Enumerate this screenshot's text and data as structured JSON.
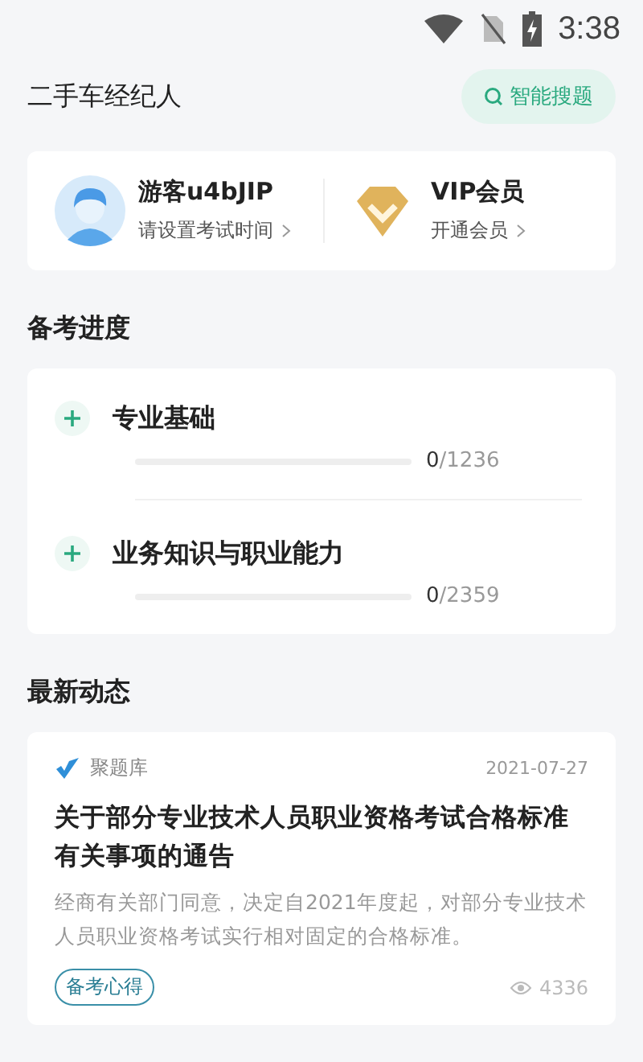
{
  "status_bar": {
    "time": "3:38"
  },
  "header": {
    "title": "二手车经纪人",
    "search_button": "智能搜题"
  },
  "profile": {
    "name": "游客u4bJIP",
    "hint": "请设置考试时间",
    "vip_title": "VIP会员",
    "vip_link": "开通会员"
  },
  "progress_section": {
    "title": "备考进度",
    "subjects": [
      {
        "name": "专业基础",
        "level": 0,
        "done": "0",
        "total": "/1236"
      },
      {
        "name": "业务知识与职业能力",
        "level": 0,
        "done": "0",
        "total": "/2359"
      }
    ]
  },
  "news_section": {
    "title": "最新动态",
    "articles": [
      {
        "source": "聚题库",
        "date": "2021-07-27",
        "title": "关于部分专业技术人员职业资格考试合格标准有关事项的通告",
        "summary": "经商有关部门同意，决定自2021年度起，对部分专业技术人员职业资格考试实行相对固定的合格标准。",
        "tag": "备考心得",
        "views": "4336"
      }
    ]
  }
}
